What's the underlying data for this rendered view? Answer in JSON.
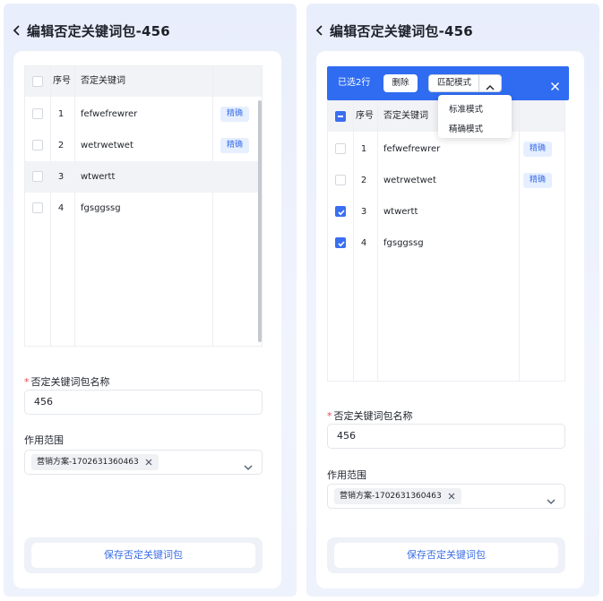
{
  "left": {
    "title": "编辑否定关键词包-456",
    "table": {
      "headers": {
        "index": "序号",
        "keyword": "否定关键词"
      },
      "rows": [
        {
          "no": "1",
          "keyword": "fefwefrewrer",
          "tag": "精确"
        },
        {
          "no": "2",
          "keyword": "wetrwetwet",
          "tag": "精确"
        },
        {
          "no": "3",
          "keyword": "wtwertt",
          "tag": ""
        },
        {
          "no": "4",
          "keyword": "fgsggssg",
          "tag": ""
        }
      ]
    },
    "name_field": {
      "label": "否定关键词包名称",
      "value": "456"
    },
    "scope_field": {
      "label": "作用范围",
      "chip": "营销方案-1702631360463"
    },
    "save_label": "保存否定关键词包"
  },
  "right": {
    "title": "编辑否定关键词包-456",
    "selection_bar": {
      "selected_text": "已选2行",
      "delete_label": "删除",
      "mode_label": "匹配模式",
      "dropdown": [
        "标准模式",
        "精确模式"
      ]
    },
    "table": {
      "headers": {
        "index": "序号",
        "keyword": "否定关键词"
      },
      "rows": [
        {
          "no": "1",
          "keyword": "fefwefrewrer",
          "tag": "精确",
          "checked": false
        },
        {
          "no": "2",
          "keyword": "wetrwetwet",
          "tag": "精确",
          "checked": false
        },
        {
          "no": "3",
          "keyword": "wtwertt",
          "tag": "",
          "checked": true
        },
        {
          "no": "4",
          "keyword": "fgsggssg",
          "tag": "",
          "checked": true
        }
      ]
    },
    "name_field": {
      "label": "否定关键词包名称",
      "value": "456"
    },
    "scope_field": {
      "label": "作用范围",
      "chip": "营销方案-1702631360463"
    },
    "save_label": "保存否定关键词包"
  },
  "colors": {
    "primary": "#2f6cf1",
    "tag_bg": "#e6efff",
    "tag_text": "#3d6fe6",
    "required": "#e5484d"
  }
}
